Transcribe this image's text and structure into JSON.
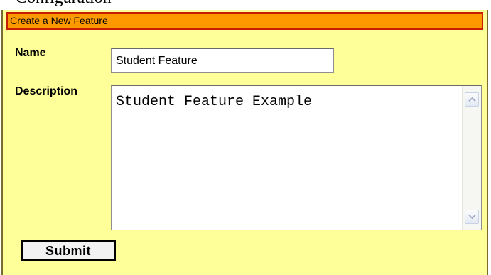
{
  "top_strip": {
    "clipped_text": "Configuration"
  },
  "form": {
    "header": "Create a New Feature",
    "name_label": "Name",
    "name_value": "Student Feature",
    "description_label": "Description",
    "description_value": "Student Feature Example",
    "submit_label": "Submit"
  },
  "icons": {
    "scroll_up": "chevron-up-icon",
    "scroll_down": "chevron-down-icon"
  },
  "colors": {
    "panel_background": "#ffff99",
    "header_background": "#ff9900",
    "header_border": "#c81e00"
  }
}
